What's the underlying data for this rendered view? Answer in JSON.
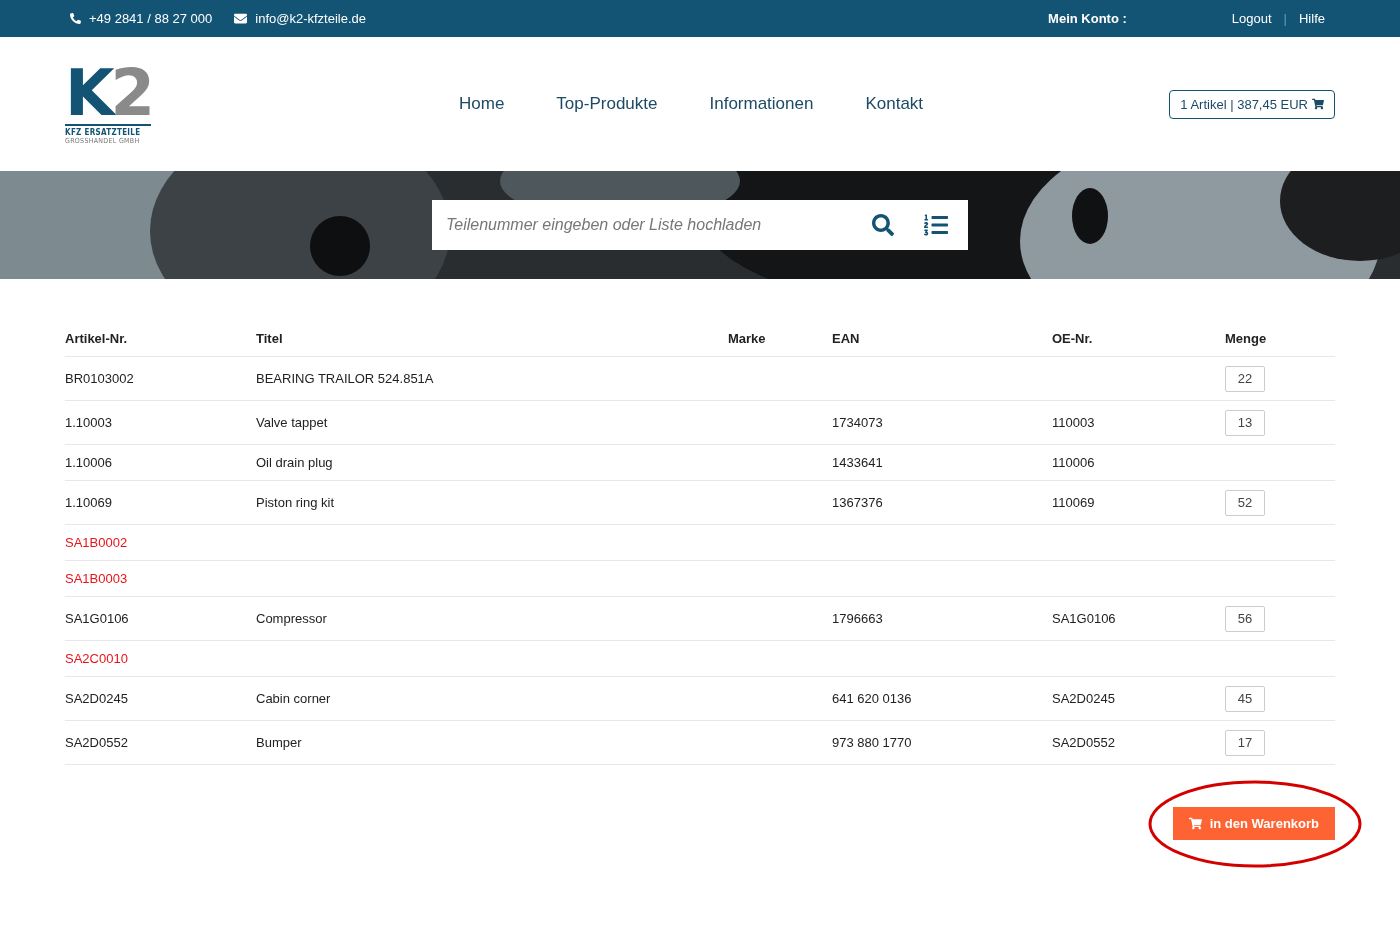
{
  "top_bar": {
    "phone": "+49 2841 / 88 27 000",
    "email": "info@k2-kfzteile.de",
    "account_label": "Mein Konto",
    "account_separator": ":",
    "links": [
      "Logout",
      "Hilfe"
    ],
    "link_separator": "|"
  },
  "logo": {
    "mark_letter": "K",
    "mark_digit": "2",
    "line1": "KFZ ERSATZTEILE",
    "line2": "GROSSHANDEL GMBH"
  },
  "nav": [
    "Home",
    "Top-Produkte",
    "Informationen",
    "Kontakt"
  ],
  "cart_summary": "1 Artikel | 387,45 EUR",
  "search": {
    "placeholder": "Teilenummer eingeben oder Liste hochladen"
  },
  "table": {
    "columns": [
      "Artikel-Nr.",
      "Titel",
      "Marke",
      "EAN",
      "OE-Nr.",
      "Menge"
    ],
    "rows": [
      {
        "article": "BR0103002",
        "title": "BEARING TRAILOR 524.851A",
        "ean": "",
        "oe": "",
        "quantity": "22",
        "missing": false
      },
      {
        "article": "1.10003",
        "title": "Valve tappet",
        "ean": "1734073",
        "oe": "110003",
        "quantity": "13",
        "missing": false
      },
      {
        "article": "1.10006",
        "title": "Oil drain plug",
        "ean": "1433641",
        "oe": "110006",
        "missing": false
      },
      {
        "article": "1.10069",
        "title": "Piston ring kit",
        "ean": "1367376",
        "oe": "110069",
        "quantity": "52",
        "missing": false
      },
      {
        "article": "SA1B0002",
        "missing": true
      },
      {
        "article": "SA1B0003",
        "missing": true
      },
      {
        "article": "SA1G0106",
        "title": "Compressor",
        "ean": "1796663",
        "oe": "SA1G0106",
        "quantity": "56",
        "missing": false
      },
      {
        "article": "SA2C0010",
        "missing": true
      },
      {
        "article": "SA2D0245",
        "title": "Cabin corner",
        "ean": "641 620 0136",
        "oe": "SA2D0245",
        "quantity": "45",
        "missing": false
      },
      {
        "article": "SA2D0552",
        "title": "Bumper",
        "ean": "973 880 1770",
        "oe": "SA2D0552",
        "quantity": "17",
        "missing": false
      }
    ]
  },
  "cart_button": {
    "label": "in den Warenkorb",
    "circled": true
  }
}
